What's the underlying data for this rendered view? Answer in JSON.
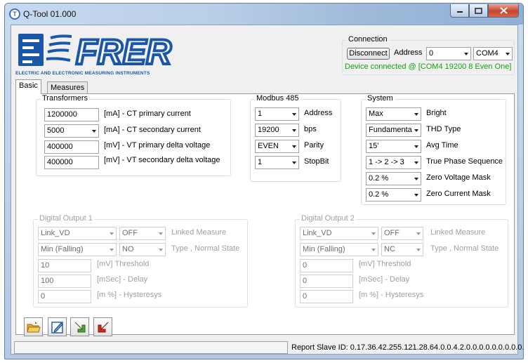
{
  "window": {
    "title": "Q-Tool 01.000",
    "icon_letter": "T"
  },
  "logo": {
    "brand": "FRER",
    "tagline": "ELECTRIC AND ELECTRONIC MEASURING INSTRUMENTS"
  },
  "connection": {
    "title": "Connection",
    "disconnect_label": "Disconnect",
    "address_label": "Address",
    "address_value": "0",
    "port_value": "COM4",
    "status": "Device connected @ [COM4 19200 8 Even One]"
  },
  "tabs": [
    {
      "label": "Basic"
    },
    {
      "label": "Measures"
    }
  ],
  "transformers": {
    "title": "Transformers",
    "rows": [
      {
        "value": "1200000",
        "label": "[mA] - CT primary current"
      },
      {
        "value": "5000",
        "label": "[mA] - CT secondary current"
      },
      {
        "value": "400000",
        "label": "[mV] - VT primary delta voltage"
      },
      {
        "value": "400000",
        "label": "[mV] - VT secondary delta voltage"
      }
    ]
  },
  "modbus": {
    "title": "Modbus 485",
    "rows": [
      {
        "value": "1",
        "label": "Address"
      },
      {
        "value": "19200",
        "label": "bps"
      },
      {
        "value": "EVEN",
        "label": "Parity"
      },
      {
        "value": "1",
        "label": "StopBit"
      }
    ]
  },
  "system": {
    "title": "System",
    "rows": [
      {
        "value": "Max",
        "label": "Bright"
      },
      {
        "value": "Fundamenta",
        "label": "THD Type"
      },
      {
        "value": "15'",
        "label": "Avg Time"
      },
      {
        "value": "1 -> 2 -> 3",
        "label": "True Phase Sequence"
      },
      {
        "value": "0.2 %",
        "label": "Zero Voltage Mask"
      },
      {
        "value": "0.2 %",
        "label": "Zero Current Mask"
      }
    ]
  },
  "digital_output_1": {
    "title": "Digital Output 1",
    "measure": "Link_VD",
    "measure_state": "OFF",
    "linked_label": "Linked Measure",
    "type": "Min (Falling)",
    "normal_state": "NO",
    "type_label": "Type , Normal State",
    "threshold": "10",
    "threshold_label": "[mV] Threshold",
    "delay": "100",
    "delay_label": "[mSec] - Delay",
    "hysteresys": "0",
    "hysteresys_label": "[m %] - Hysteresys"
  },
  "digital_output_2": {
    "title": "Digital Output 2",
    "measure": "Link_VD",
    "measure_state": "OFF",
    "linked_label": "Linked Measure",
    "type": "Min (Falling)",
    "normal_state": "NC",
    "type_label": "Type , Normal State",
    "threshold": "0",
    "threshold_label": "[mV] Threshold",
    "delay": "0",
    "delay_label": "[mSec] - Delay",
    "hysteresys": "0",
    "hysteresys_label": "[m %] - Hysteresys"
  },
  "toolbar": {
    "icons": [
      "open-folder-icon",
      "edit-icon",
      "read-arrow-icon",
      "write-arrow-icon"
    ]
  },
  "statusbar": {
    "text": "Report Slave ID: 0.17.36.42.255.121.28.64.0.0.4.2.0.0.0.0.0.0.0.0.0.0.0.0.0.0.0."
  },
  "colors": {
    "brand_blue": "#1b57a8",
    "status_green": "#13a010"
  }
}
